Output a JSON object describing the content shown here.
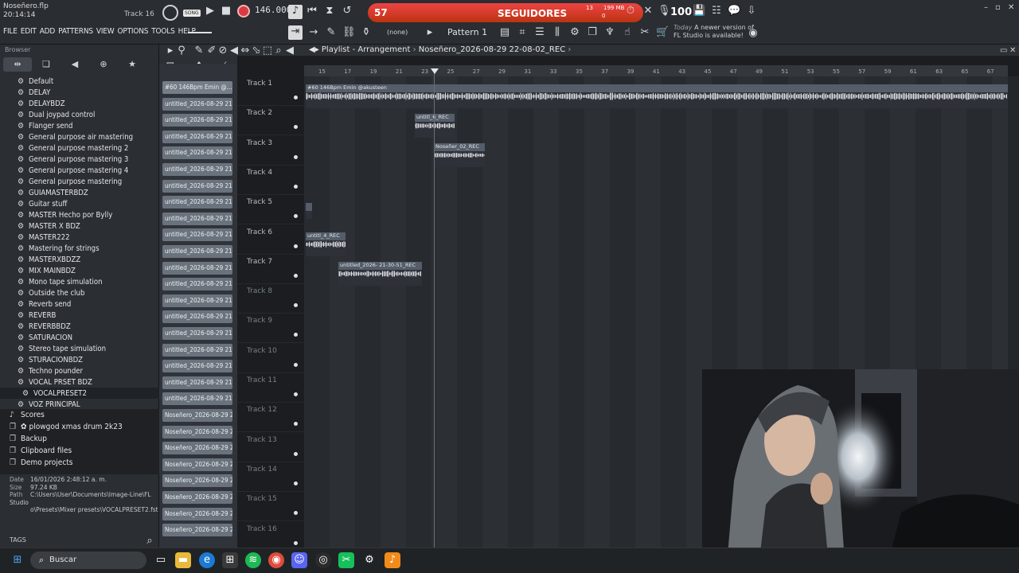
{
  "window": {
    "file_title": "Noseñero.flp",
    "clock": "20:14:14",
    "track_hint": "Track 16",
    "song_badge": "SONG",
    "bpm": "146.000",
    "pattern": "Pattern 1",
    "none_label": "(none)",
    "update_today": "Today",
    "update_text_1": "A newer version of",
    "update_text_2": "FL Studio is available!",
    "memory": "199 MB",
    "controls": {
      "minimize": "–",
      "maximize": "▫",
      "close": "✕"
    }
  },
  "menu": [
    "FILE",
    "EDIT",
    "ADD",
    "PATTERNS",
    "VIEW",
    "OPTIONS",
    "TOOLS",
    "HELP"
  ],
  "overlay": {
    "follower_count": "57",
    "label": "SEGUIDORES",
    "mini_top": "13",
    "mini_bottom": "0",
    "volume": "100"
  },
  "browser": {
    "header": "Browser",
    "items": [
      "Default",
      "DELAY",
      "DELAYBDZ",
      "Dual joypad control",
      "Flanger send",
      "General purpose air mastering",
      "General purpose mastering 2",
      "General purpose mastering 3",
      "General purpose mastering 4",
      "General purpose mastering",
      "GUIAMASTERBDZ",
      "Guitar stuff",
      "MASTER Hecho por Bylly",
      "MASTER X BDZ",
      "MASTER222",
      "Mastering for strings",
      "MASTERXBDZZ",
      "MIX MAINBDZ",
      "Mono tape simulation",
      "Outside the club",
      "Reverb send",
      "REVERB",
      "REVERBBDZ",
      "SATURACION",
      "Stereo tape simulation",
      "STURACIONBDZ",
      "Techno pounder",
      "VOCAL PRSET BDZ",
      "VOCALPRESET2",
      "VOZ PRINCIPAL"
    ],
    "selected_index": 28,
    "folders": [
      "Scores",
      "plowgod xmas drum 2k23",
      "Backup",
      "Clipboard files",
      "Demo projects"
    ],
    "info": {
      "date_key": "Date",
      "date": "16/01/2026 2:48:12 a. m.",
      "size_key": "Size",
      "size": "97.24 KB",
      "path_key": "Path",
      "path_1": "C:\\Users\\User\\Documents\\Image-Line\\FL Studio",
      "path_2": "o\\Presets\\Mixer presets\\VOCALPRESET2.fst"
    },
    "tags_label": "TAGS"
  },
  "playlist": {
    "title": "Playlist - Arrangement",
    "song": "Noseñero_2026-08-29 22-08-02_REC",
    "ruler": [
      "15",
      "17",
      "19",
      "21",
      "23",
      "25",
      "27",
      "29",
      "31",
      "33",
      "35",
      "37",
      "39",
      "41",
      "43",
      "45",
      "47",
      "49",
      "51",
      "53",
      "55",
      "57",
      "59",
      "61",
      "63",
      "65",
      "67"
    ],
    "clip_sources": [
      "#60 146Bpm Emin @...",
      "untitled_2026-08-29 21-...",
      "untitled_2026-08-29 21-...",
      "untitled_2026-08-29 21-...",
      "untitled_2026-08-29 21-...",
      "untitled_2026-08-29 21-...",
      "untitled_2026-08-29 21-...",
      "untitled_2026-08-29 21-...",
      "untitled_2026-08-29 21-...",
      "untitled_2026-08-29 21-...",
      "untitled_2026-08-29 21-...",
      "untitled_2026-08-29 21-...",
      "untitled_2026-08-29 21-...",
      "untitled_2026-08-29 21-...",
      "untitled_2026-08-29 21-...",
      "untitled_2026-08-29 21-...",
      "untitled_2026-08-29 21-...",
      "untitled_2026-08-29 21-...",
      "untitled_2026-08-29 21-...",
      "untitled_2026-08-29 21-...",
      "Noseñero_2026-08-29 2...",
      "Noseñero_2026-08-29 2...",
      "Noseñero_2026-08-29 2...",
      "Noseñero_2026-08-29 2...",
      "Noseñero_2026-08-29 2...",
      "Noseñero_2026-08-29 2...",
      "Noseñero_2026-08-29 2...",
      "Noseñero_2026-08-29 2..."
    ],
    "tracks": [
      "Track 1",
      "Track 2",
      "Track 3",
      "Track 4",
      "Track 5",
      "Track 6",
      "Track 7",
      "Track 8",
      "Track 9",
      "Track 10",
      "Track 11",
      "Track 12",
      "Track 13",
      "Track 14",
      "Track 15",
      "Track 16"
    ],
    "clips": [
      {
        "label": "#60 146Bpm Emin @akusteen"
      },
      {
        "label": "untitl_6_REC"
      },
      {
        "label": "Noseñer_02_REC"
      },
      {
        "label": "untitl_4_REC"
      },
      {
        "label": "untitled_2026- 21-30-51_REC"
      }
    ]
  },
  "taskbar": {
    "search_label": "Buscar",
    "apps": [
      "windows-start",
      "search",
      "task-view",
      "file-explorer",
      "edge",
      "store",
      "spotify",
      "chrome",
      "discord",
      "obs",
      "capcut",
      "settings",
      "fl-studio"
    ]
  }
}
